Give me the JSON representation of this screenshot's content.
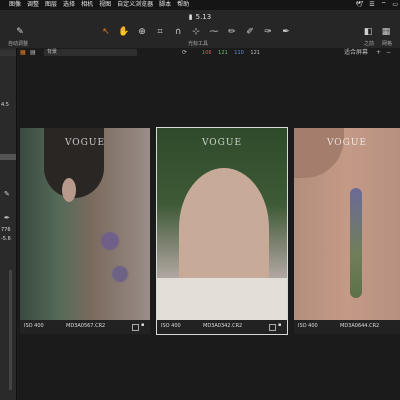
{
  "menubar": {
    "items": [
      "图像",
      "调整",
      "图层",
      "选择",
      "相机",
      "视图",
      "自定义浏览器",
      "脚本",
      "帮助"
    ],
    "status_icons": [
      "bird-icon",
      "menu-icon",
      "wifi-icon",
      "battery-icon"
    ]
  },
  "window": {
    "title": "5.13"
  },
  "toolbar": {
    "auto_adjust_label": "自动调整",
    "cursor_tools_label": "光标工具",
    "before_label": "之前",
    "grid_label": "网格"
  },
  "browser": {
    "folder_dropdown": "背景",
    "rgb": {
      "r": "106",
      "g": "121",
      "b": "110",
      "a": "121"
    },
    "zoom_label": "适合屏幕"
  },
  "left_panel": {
    "values": [
      "4.5",
      "776",
      "-5.6"
    ]
  },
  "thumbnails": [
    {
      "iso": "ISO 400",
      "filename": "MD3A0567.CR2",
      "caption_overlay": "VOGUE",
      "selected": false
    },
    {
      "iso": "ISO 400",
      "filename": "MD3A0342.CR2",
      "caption_overlay": "VOGUE",
      "selected": true
    },
    {
      "iso": "ISO 400",
      "filename": "MD3A0644.CR2",
      "caption_overlay": "VOGUE",
      "selected": false
    }
  ],
  "colors": {
    "accent": "#e07b1f",
    "background": "#1e1e1e",
    "red": "#e05a5a",
    "green": "#69c46b",
    "blue": "#5a8ee0"
  }
}
